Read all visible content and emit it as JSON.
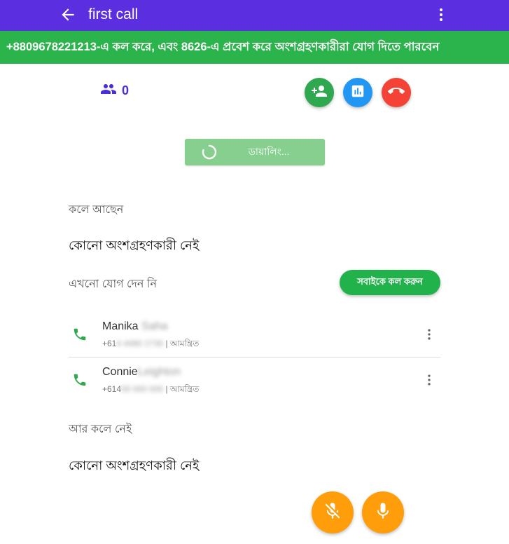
{
  "header": {
    "title": "first call"
  },
  "banner": {
    "text": "+8809678221213-এ কল করে, এবং 8626-এ প্রবেশ করে অংশগ্রহণকারীরা যোগ দিতে পারবেন"
  },
  "participants": {
    "count": "0"
  },
  "dialing": {
    "label": "ডায়ালিং..."
  },
  "in_call": {
    "heading": "কলে আছেন",
    "empty": "কোনো অংশগ্রহণকারী নেই"
  },
  "not_joined": {
    "heading": "এখনো যোগ দেন নি",
    "call_all_label": "সবাইকে কল করুন",
    "rows": [
      {
        "first_name": "Manika",
        "last_name": "Saha",
        "phone_prefix": "+61",
        "phone_rest": "4 4480 2730",
        "status": "| আমন্ত্রিত"
      },
      {
        "first_name": "Connie",
        "last_name": "Leighton",
        "phone_prefix": "+614",
        "phone_rest": "00 000 000",
        "status": "| আমন্ত্রিত"
      }
    ]
  },
  "left_call": {
    "heading": "আর কলে নেই",
    "empty": "কোনো অংশগ্রহণকারী নেই"
  },
  "colors": {
    "header": "#5b2ee0",
    "banner": "#2bb44c",
    "end": "#f44336",
    "mic": "#ff9d0a"
  }
}
